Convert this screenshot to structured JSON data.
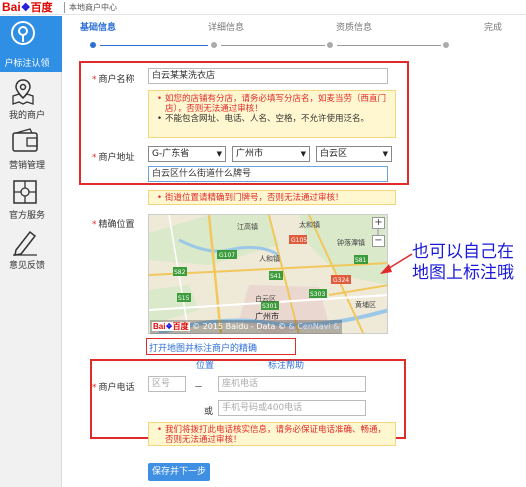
{
  "header": {
    "logo_bai": "Bai",
    "logo_paw": "du",
    "logo_baidu": "百度",
    "site_title": "本地商户中心"
  },
  "sidebar": {
    "items": [
      {
        "label": "户标注认领",
        "icon": "location-pin-icon",
        "active": true
      },
      {
        "label": "我的商户",
        "icon": "map-icon",
        "active": false
      },
      {
        "label": "营销管理",
        "icon": "wallet-icon",
        "active": false
      },
      {
        "label": "官方服务",
        "icon": "service-icon",
        "active": false
      },
      {
        "label": "意见反馈",
        "icon": "pencil-icon",
        "active": false
      }
    ]
  },
  "steps": [
    "基础信息",
    "详细信息",
    "资质信息",
    "完成"
  ],
  "form": {
    "name_label": "商户名称",
    "name_value": "白云某某洗衣店",
    "name_warning_1": "如您的店铺有分店，请务必填写分店名，如麦当劳（西直门店），否则无法通过审核！",
    "name_warning_2": "不能包含网址、电话、人名、空格，不允许使用泛名。",
    "address_label": "商户地址",
    "province": "G-广东省",
    "city": "广州市",
    "district": "白云区",
    "street_value": "白云区什么街道什么牌号",
    "address_warning": "街道位置请精确到门牌号，否则无法通过审核！",
    "location_label": "精确位置",
    "map_link": "打开地图并标注商户的精确",
    "position_link": "位置",
    "help_link": "标注帮助",
    "phone_label": "商户电话",
    "area_code_placeholder": "区号",
    "dash": "－",
    "landline_placeholder": "座机电话",
    "or_label": "或",
    "mobile_placeholder": "手机号码或400电话",
    "phone_warning": "我们将拨打此电话核实信息，请务必保证电话准确、畅通，否则无法通过审核！",
    "save_button": "保存并下一步"
  },
  "map": {
    "places": [
      "江高镇",
      "太和镇",
      "钟落潭镇",
      "人和镇",
      "白云区",
      "广州市",
      "黄埔区"
    ],
    "roads": [
      "G107",
      "S82",
      "G105",
      "G324",
      "S303",
      "S15",
      "S41",
      "S301",
      "S81"
    ],
    "copyright": "© 2015 Baidu - Data ©",
    "copyright_tail": "& CenNavi &"
  },
  "annotation": "也可以自己在地图上标注哦",
  "colors": {
    "accent": "#2f6fd6",
    "warning_red": "#e02b2b",
    "sidebar_active": "#2f8fe5"
  }
}
